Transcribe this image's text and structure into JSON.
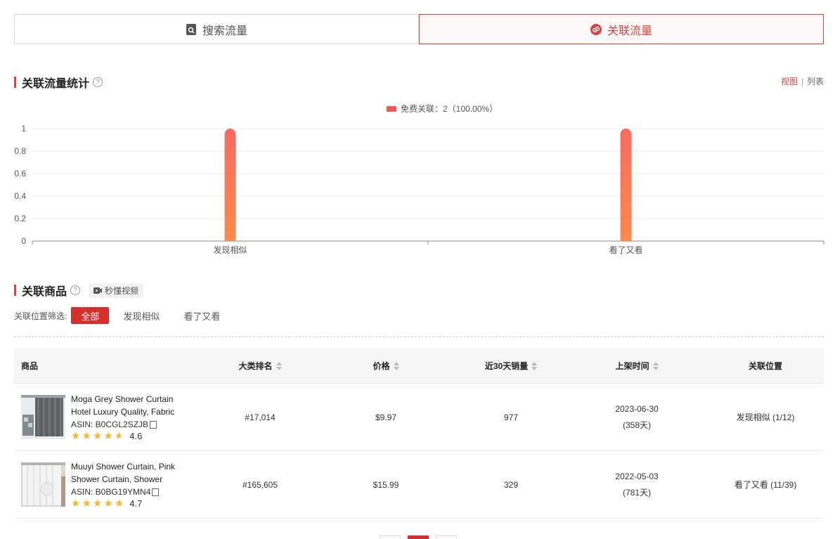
{
  "tabs": [
    {
      "label": "搜索流量",
      "icon": "search-doc-icon",
      "active": false
    },
    {
      "label": "关联流量",
      "icon": "link-icon",
      "active": true
    }
  ],
  "stats_section": {
    "title": "关联流量统计",
    "view_label": "视图",
    "list_label": "列表",
    "separator": "|"
  },
  "chart_data": {
    "type": "bar",
    "categories": [
      "发现相似",
      "看了又看"
    ],
    "series": [
      {
        "name": "免费关联",
        "values": [
          1,
          1
        ]
      }
    ],
    "legend_text": "免费关联：2（100.00%）",
    "yticks": [
      "0",
      "0.2",
      "0.4",
      "0.6",
      "0.8",
      "1"
    ],
    "ylim": [
      0,
      1
    ],
    "grid": true,
    "legend_position": "top-center",
    "bar_color_top": "#f76b61",
    "bar_color_bottom": "#fb8a4c"
  },
  "products_section": {
    "title": "关联商品",
    "video_label": "秒懂视频"
  },
  "filter": {
    "label": "关联位置筛选:",
    "options": [
      "全部",
      "发现相似",
      "看了又看"
    ]
  },
  "table": {
    "headers": {
      "product": "商品",
      "rank": "大类排名",
      "price": "价格",
      "sales": "近30天销量",
      "listed": "上架时间",
      "position": "关联位置"
    },
    "rows": [
      {
        "title": "Moga Grey Shower Curtain Hotel Luxury Quality, Fabric Sho...",
        "asin": "ASIN: B0CGL2SZJB",
        "rating": "4.6",
        "rank": "#17,014",
        "price": "$9.97",
        "sales": "977",
        "date": "2023-06-30",
        "days": "(358天)",
        "position": "发现相似 (1/12)"
      },
      {
        "title": "Muuyi Shower Curtain, Pink Shower Curtain, Shower Curtai...",
        "asin": "ASIN: B0BG19YMN4",
        "rating": "4.7",
        "rank": "#165,605",
        "price": "$15.99",
        "sales": "329",
        "date": "2022-05-03",
        "days": "(781天)",
        "position": "看了又看 (11/39)"
      }
    ]
  },
  "colors": {
    "accent": "#d6453d",
    "star": "#f5b82e"
  }
}
